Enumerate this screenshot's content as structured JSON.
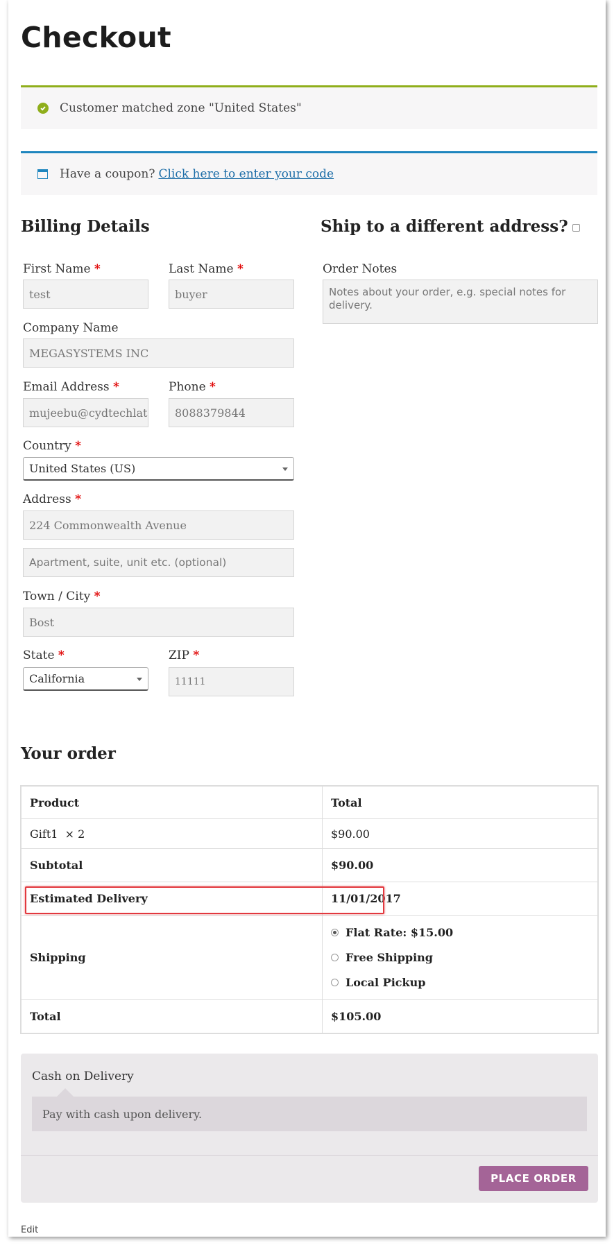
{
  "page": {
    "title": "Checkout"
  },
  "notices": {
    "zone_message": "Customer matched zone \"United States\"",
    "coupon_prompt": "Have a coupon?",
    "coupon_link": "Click here to enter your code"
  },
  "billing": {
    "heading": "Billing Details",
    "required_mark": "*",
    "first_name": {
      "label": "First Name",
      "value": "test"
    },
    "last_name": {
      "label": "Last Name",
      "value": "buyer"
    },
    "company": {
      "label": "Company Name",
      "value": "MEGASYSTEMS INC"
    },
    "email": {
      "label": "Email Address",
      "value": "mujeebu@cydtechlat"
    },
    "phone": {
      "label": "Phone",
      "value": "8088379844"
    },
    "country": {
      "label": "Country",
      "value": "United States (US)"
    },
    "address": {
      "label": "Address",
      "value": "224 Commonwealth Avenue",
      "line2_placeholder": "Apartment, suite, unit etc. (optional)"
    },
    "city": {
      "label": "Town / City",
      "value": "Bost"
    },
    "state": {
      "label": "State",
      "value": "California"
    },
    "zip": {
      "label": "ZIP",
      "value": "11111"
    }
  },
  "shipping": {
    "heading": "Ship to a different address?",
    "order_notes_label": "Order Notes",
    "order_notes_placeholder": "Notes about your order, e.g. special notes for delivery."
  },
  "order": {
    "heading": "Your order",
    "col_product": "Product",
    "col_total": "Total",
    "item_name": "Gift1",
    "item_qty": "× 2",
    "item_total": "$90.00",
    "subtotal_label": "Subtotal",
    "subtotal_value": "$90.00",
    "delivery_label": "Estimated Delivery",
    "delivery_value": "11/01/2017",
    "shipping_label": "Shipping",
    "shipping_options": [
      "Flat Rate: $15.00",
      "Free Shipping",
      "Local Pickup"
    ],
    "shipping_selected": 0,
    "total_label": "Total",
    "total_value": "$105.00"
  },
  "payment": {
    "method": "Cash on Delivery",
    "description": "Pay with cash upon delivery.",
    "place_order": "PLACE ORDER"
  },
  "footer": {
    "edit": "Edit"
  },
  "colors": {
    "success": "#8fae1b",
    "info": "#1e85be",
    "button": "#a46497",
    "required": "#e00000",
    "highlight": "#e2393f"
  }
}
